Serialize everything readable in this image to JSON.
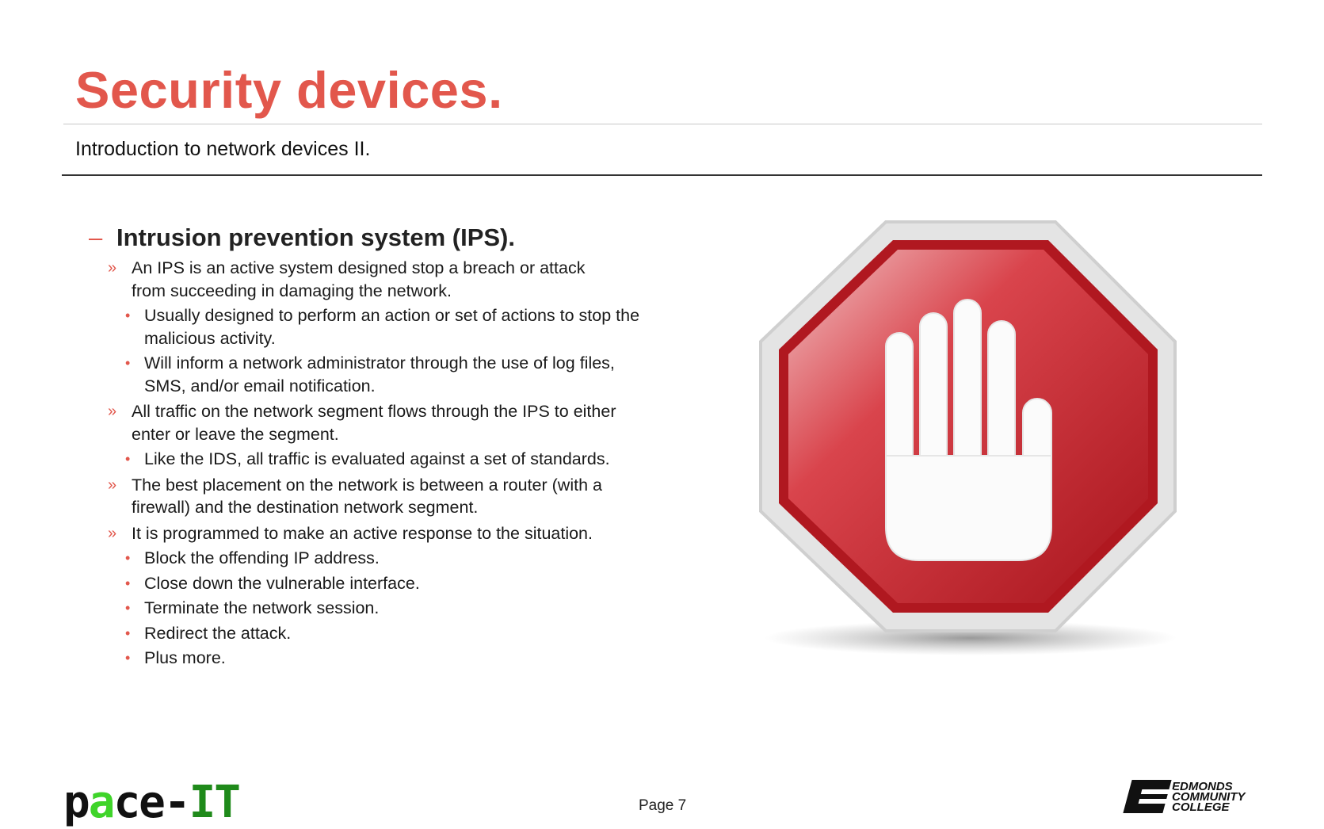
{
  "slide": {
    "title": "Security devices.",
    "subtitle": "Introduction to network devices II.",
    "heading": "Intrusion prevention system (IPS).",
    "items": [
      {
        "level": 1,
        "text": "An IPS is an active system designed stop a breach or attack from succeeding in damaging the network."
      },
      {
        "level": 2,
        "text": "Usually designed to perform an action or set of actions to stop the malicious activity."
      },
      {
        "level": 2,
        "text": "Will inform a network administrator through the use of log files, SMS, and/or email notification."
      },
      {
        "level": 1,
        "text": "All traffic on the network segment flows through the IPS to either enter or leave the segment."
      },
      {
        "level": 2,
        "text": "Like the IDS, all traffic is evaluated against a set of standards."
      },
      {
        "level": 1,
        "text": "The best placement on the network is between a router (with a firewall) and the destination network segment."
      },
      {
        "level": 1,
        "text": "It is programmed to make an active response to the situation."
      },
      {
        "level": 2,
        "text": "Block the offending IP address."
      },
      {
        "level": 2,
        "text": "Close down the vulnerable interface."
      },
      {
        "level": 2,
        "text": "Terminate the network session."
      },
      {
        "level": 2,
        "text": "Redirect the attack."
      },
      {
        "level": 2,
        "text": "Plus more."
      }
    ],
    "bullets": {
      "heading": "–",
      "level1": "»",
      "level2": "•"
    },
    "page_label": "Page 7"
  },
  "footer": {
    "logo_left": {
      "p1": "p",
      "p2": "a",
      "p3": "ce-",
      "p4": "IT"
    },
    "logo_right": [
      "EDMONDS",
      "COMMUNITY",
      "COLLEGE"
    ]
  },
  "colors": {
    "accent": "#e2574c",
    "sign_red": "#c8202a",
    "logo_green": "#3fd42a"
  }
}
